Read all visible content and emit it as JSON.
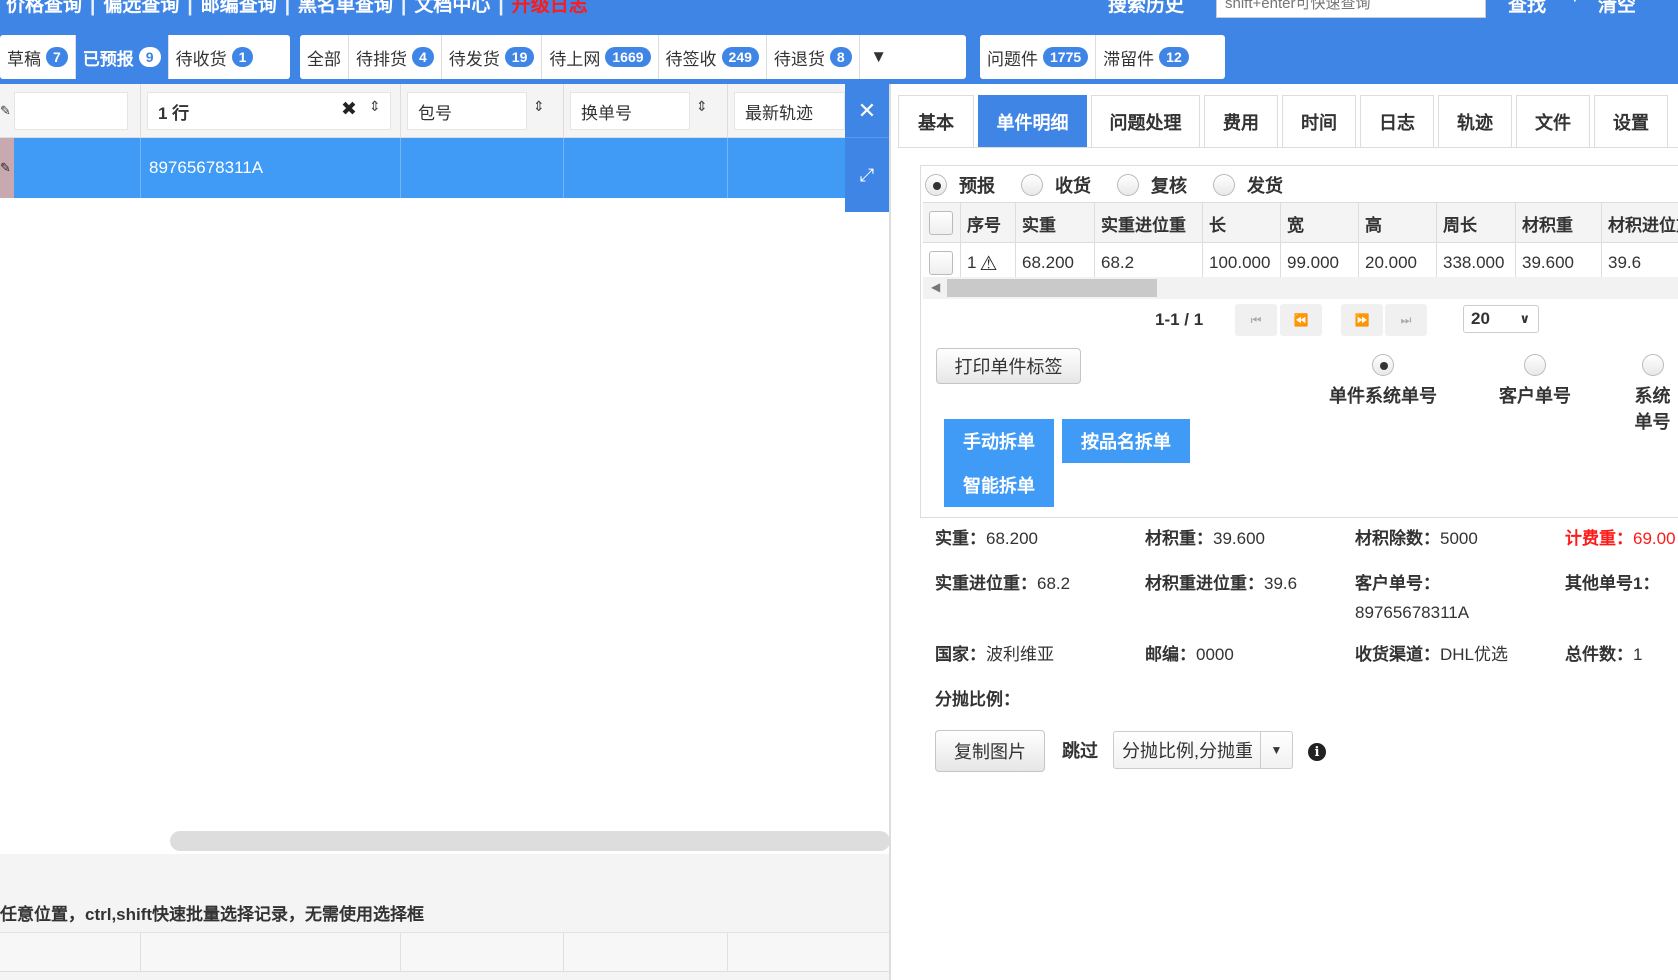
{
  "topnav": {
    "items": [
      "价格查询",
      "偏远查询",
      "邮编查询",
      "黑名单查询",
      "文档中心",
      "升级日志"
    ],
    "search_history": "搜索历史",
    "search_placeholder": "shift+enter可快速查询",
    "search_btn": "查找",
    "dot": "·",
    "clear_btn": "清空"
  },
  "status_groups": [
    [
      {
        "label": "草稿",
        "count": "7"
      },
      {
        "label": "已预报",
        "count": "9",
        "active": true
      },
      {
        "label": "待收货",
        "count": "1"
      }
    ],
    [
      {
        "label": "全部",
        "count": ""
      },
      {
        "label": "待排货",
        "count": "4"
      },
      {
        "label": "待发货",
        "count": "19"
      },
      {
        "label": "待上网",
        "count": "1669"
      },
      {
        "label": "待签收",
        "count": "249"
      },
      {
        "label": "待退货",
        "count": "8"
      }
    ],
    [
      {
        "label": "问题件",
        "count": "1775"
      },
      {
        "label": "滞留件",
        "count": "12"
      }
    ]
  ],
  "grid": {
    "filter_value": "1 行",
    "columns": [
      "包号",
      "换单号",
      "最新轨迹"
    ],
    "row": {
      "tracking_no": "89765678311A",
      "bag_no": "",
      "new_no": "",
      "latest": ""
    },
    "footer_hint": "点击任意位置，ctrl,shift快速批量选择记录，无需使用选择框"
  },
  "tabs": [
    "基本",
    "单件明细",
    "问题处理",
    "费用",
    "时间",
    "日志",
    "轨迹",
    "文件",
    "设置"
  ],
  "active_tab": "单件明细",
  "detail": {
    "mode_radios": [
      "预报",
      "收货",
      "复核",
      "发货"
    ],
    "mode_selected": "预报",
    "columns": [
      "序号",
      "实重",
      "实重进位重",
      "长",
      "宽",
      "高",
      "周长",
      "材积重",
      "材积进位重"
    ],
    "rows": [
      {
        "seq": "1",
        "actual": "68.200",
        "actual_round": "68.2",
        "length": "100.000",
        "width": "99.000",
        "height": "20.000",
        "girth": "338.000",
        "vol": "39.600",
        "vol_round": "39.6"
      }
    ],
    "pager": {
      "text": "1-1 / 1",
      "page_size": "20"
    }
  },
  "print_label_btn": "打印单件标签",
  "id_radios": [
    "单件系统单号",
    "客户单号",
    "系统单号"
  ],
  "split_buttons": [
    "手动拆单",
    "按品名拆单",
    "智能拆单"
  ],
  "info": {
    "actual_weight_label": "实重：",
    "actual_weight": "68.200",
    "vol_weight_label": "材积重：",
    "vol_weight": "39.600",
    "vol_divisor_label": "材积除数：",
    "vol_divisor": "5000",
    "charge_weight_label": "计费重：",
    "charge_weight": "69.00",
    "actual_round_label": "实重进位重：",
    "actual_round": "68.2",
    "vol_round_label": "材积重进位重：",
    "vol_round": "39.6",
    "customer_no_label": "客户单号：",
    "customer_no": "89765678311A",
    "other_no_label": "其他单号1：",
    "country_label": "国家：",
    "country": "波利维亚",
    "postcode_label": "邮编：",
    "postcode": "0000",
    "channel_label": "收货渠道：",
    "channel": "DHL优选",
    "pieces_label": "总件数：",
    "pieces": "1",
    "ratio_label": "分抛比例："
  },
  "copy_image_btn": "复制图片",
  "jump_label": "跳过",
  "jump_value": "分抛比例,分抛重"
}
